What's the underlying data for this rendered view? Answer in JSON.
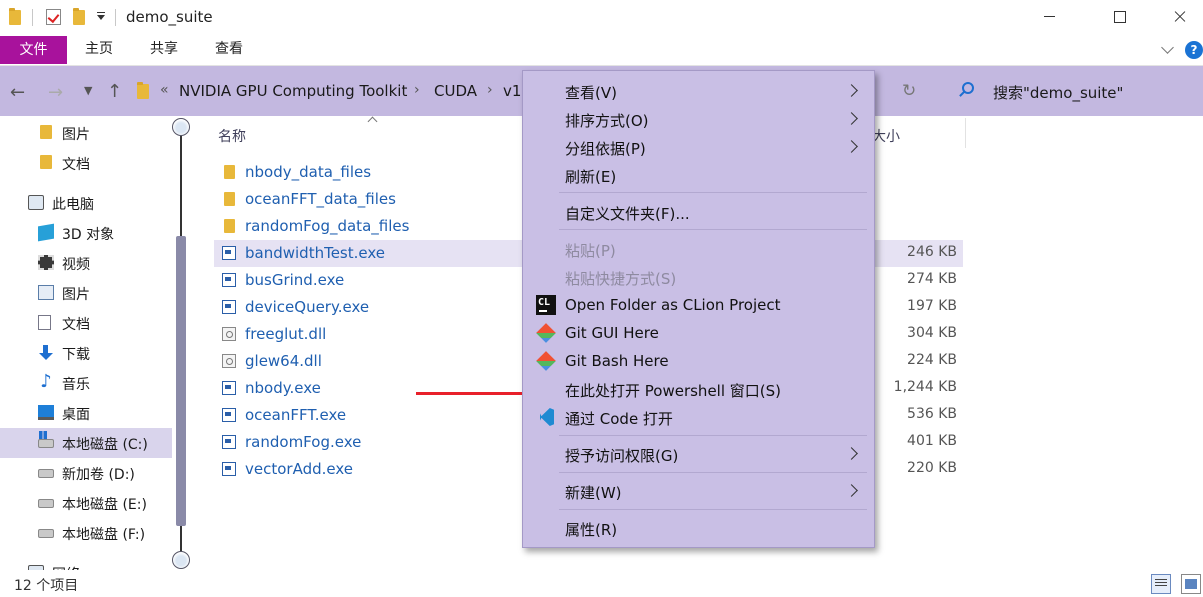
{
  "window": {
    "title": "demo_suite"
  },
  "ribbon": {
    "tabs": [
      "文件",
      "主页",
      "共享",
      "查看"
    ],
    "help_glyph": "?"
  },
  "address": {
    "crumbs": [
      "NVIDIA GPU Computing Toolkit",
      "CUDA",
      "v1"
    ],
    "overflow": "«",
    "separator": "›",
    "search_placeholder": "搜索\"demo_suite\""
  },
  "sidebar": {
    "items": [
      {
        "label": "图片",
        "icon": "folder-icon"
      },
      {
        "label": "文档",
        "icon": "folder-icon"
      },
      {
        "label": "此电脑",
        "icon": "computer-icon"
      },
      {
        "label": "3D 对象",
        "icon": "3d-objects-icon"
      },
      {
        "label": "视频",
        "icon": "video-icon"
      },
      {
        "label": "图片",
        "icon": "pictures-icon"
      },
      {
        "label": "文档",
        "icon": "documents-icon"
      },
      {
        "label": "下载",
        "icon": "download-icon"
      },
      {
        "label": "音乐",
        "icon": "music-icon"
      },
      {
        "label": "桌面",
        "icon": "desktop-icon"
      },
      {
        "label": "本地磁盘 (C:)",
        "icon": "system-drive-icon"
      },
      {
        "label": "新加卷 (D:)",
        "icon": "drive-icon"
      },
      {
        "label": "本地磁盘 (E:)",
        "icon": "drive-icon"
      },
      {
        "label": "本地磁盘 (F:)",
        "icon": "drive-icon"
      },
      {
        "label": "网络",
        "icon": "network-icon"
      }
    ],
    "selected_index": 10
  },
  "filelist": {
    "columns": {
      "name": "名称",
      "size": "大小"
    },
    "rows": [
      {
        "name": "nbody_data_files",
        "size": "",
        "type": "folder"
      },
      {
        "name": "oceanFFT_data_files",
        "size": "",
        "type": "folder"
      },
      {
        "name": "randomFog_data_files",
        "size": "",
        "type": "folder"
      },
      {
        "name": "bandwidthTest.exe",
        "size": "246 KB",
        "type": "exe"
      },
      {
        "name": "busGrind.exe",
        "size": "274 KB",
        "type": "exe"
      },
      {
        "name": "deviceQuery.exe",
        "size": "197 KB",
        "type": "exe"
      },
      {
        "name": "freeglut.dll",
        "size": "304 KB",
        "type": "dll"
      },
      {
        "name": "glew64.dll",
        "size": "224 KB",
        "type": "dll"
      },
      {
        "name": "nbody.exe",
        "size": "1,244 KB",
        "type": "exe"
      },
      {
        "name": "oceanFFT.exe",
        "size": "536 KB",
        "type": "exe"
      },
      {
        "name": "randomFog.exe",
        "size": "401 KB",
        "type": "exe"
      },
      {
        "name": "vectorAdd.exe",
        "size": "220 KB",
        "type": "exe"
      }
    ],
    "selected_index": 3
  },
  "status": {
    "count": "12 个项目"
  },
  "context_menu": {
    "items": [
      {
        "label": "查看(V)",
        "submenu": true
      },
      {
        "label": "排序方式(O)",
        "submenu": true
      },
      {
        "label": "分组依据(P)",
        "submenu": true
      },
      {
        "label": "刷新(E)"
      },
      {
        "label": "自定义文件夹(F)..."
      },
      {
        "label": "粘贴(P)",
        "disabled": true
      },
      {
        "label": "粘贴快捷方式(S)",
        "disabled": true
      },
      {
        "label": "Open Folder as CLion Project",
        "icon": "clion-icon",
        "icon_text": "CL"
      },
      {
        "label": "Git GUI Here",
        "icon": "git-icon"
      },
      {
        "label": "Git Bash Here",
        "icon": "git-icon"
      },
      {
        "label": "在此处打开 Powershell 窗口(S)"
      },
      {
        "label": "通过 Code 打开",
        "icon": "vscode-icon"
      },
      {
        "label": "授予访问权限(G)",
        "submenu": true
      },
      {
        "label": "新建(W)",
        "submenu": true
      },
      {
        "label": "属性(R)"
      }
    ]
  },
  "colors": {
    "file_tab": "#a8129c",
    "addressbar": "#c3b8e0",
    "menu_bg": "#c9bfe5",
    "annotation_arrow": "#e8202a",
    "file_link": "#1f5fb0"
  }
}
